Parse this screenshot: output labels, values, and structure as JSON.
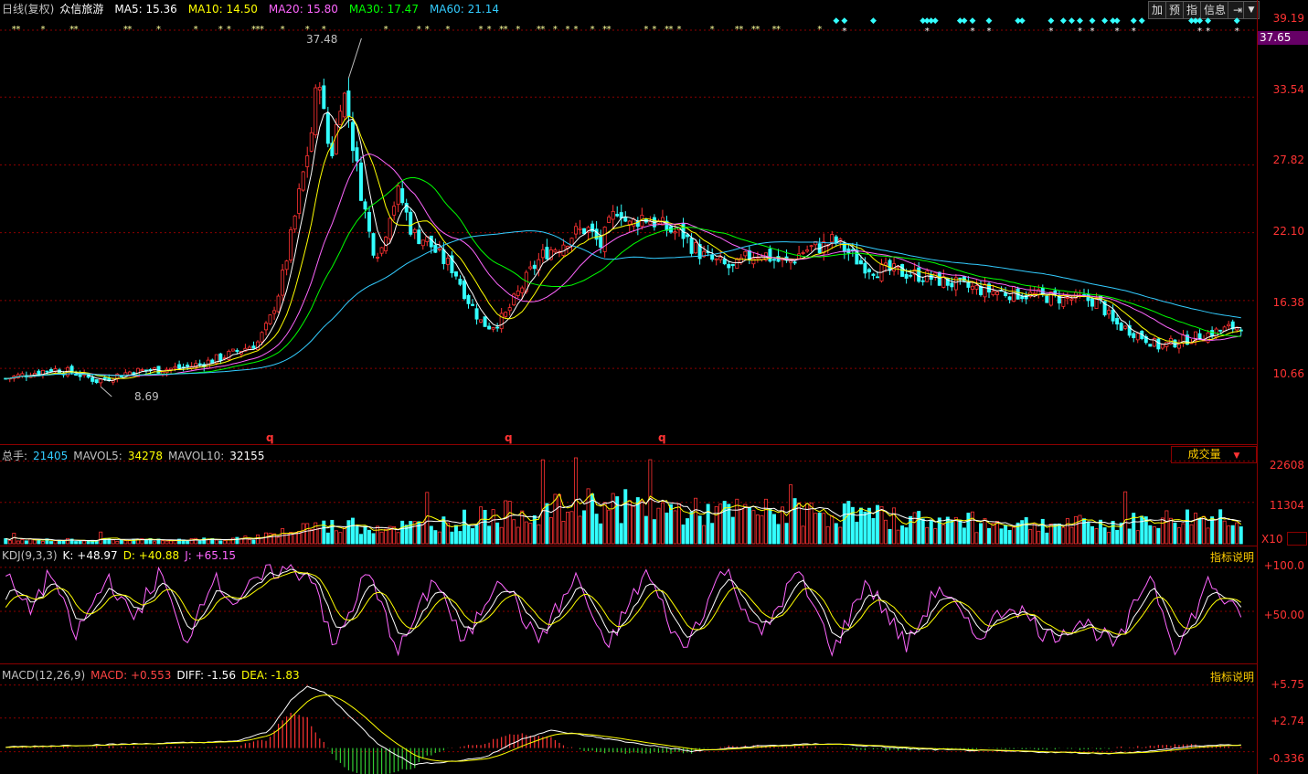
{
  "header": {
    "period": "日线(复权)",
    "stock_name": "众信旅游",
    "ma": [
      {
        "label": "MA5: 15.36",
        "color": "#ffffff"
      },
      {
        "label": "MA10: 14.50",
        "color": "#ffff00"
      },
      {
        "label": "MA20: 15.80",
        "color": "#ff66ff"
      },
      {
        "label": "MA30: 17.47",
        "color": "#00ff00"
      },
      {
        "label": "MA60: 21.14",
        "color": "#33ccff"
      }
    ],
    "buttons": [
      "加",
      "预",
      "指",
      "信息"
    ],
    "arrow_icon": "exit-arrow-icon",
    "dropdown_icon": "chevron-down-icon"
  },
  "price_axis": {
    "ticks": [
      "39.19",
      "33.54",
      "27.82",
      "22.10",
      "16.38",
      "10.66"
    ],
    "highlight": "37.65"
  },
  "annotations": {
    "high": "37.48",
    "low": "8.69",
    "markers": [
      "q",
      "q",
      "q"
    ]
  },
  "volume": {
    "header": [
      {
        "label": "总手:",
        "color": "#c0c0c0"
      },
      {
        "label": "21405",
        "color": "#33ccff"
      },
      {
        "label": "MAVOL5:",
        "color": "#c0c0c0"
      },
      {
        "label": "34278",
        "color": "#ffff00"
      },
      {
        "label": "MAVOL10:",
        "color": "#c0c0c0"
      },
      {
        "label": "32155",
        "color": "#ffffff"
      }
    ],
    "dropdown": "成交量",
    "ticks": [
      "22608",
      "11304"
    ],
    "unit": "X10"
  },
  "kdj": {
    "header": [
      {
        "label": "KDJ(9,3,3)",
        "color": "#c0c0c0"
      },
      {
        "label": "K: +48.97",
        "color": "#ffffff"
      },
      {
        "label": "D: +40.88",
        "color": "#ffff00"
      },
      {
        "label": "J: +65.15",
        "color": "#ff66ff"
      }
    ],
    "link": "指标说明",
    "ticks": [
      "+100.0",
      "+50.00"
    ]
  },
  "macd": {
    "header": [
      {
        "label": "MACD(12,26,9)",
        "color": "#c0c0c0"
      },
      {
        "label": "MACD: +0.553",
        "color": "#ff4444"
      },
      {
        "label": "DIFF: -1.56",
        "color": "#ffffff"
      },
      {
        "label": "DEA: -1.83",
        "color": "#ffff00"
      }
    ],
    "link": "指标说明",
    "ticks": [
      "+5.75",
      "+2.74",
      "-0.336"
    ]
  },
  "chart_data": {
    "type": "candlestick",
    "title": "众信旅游 日线(复权)",
    "ylim": [
      5.5,
      40.5
    ],
    "n": 300,
    "price_knots": [
      [
        0,
        9.8
      ],
      [
        20,
        10.6
      ],
      [
        30,
        10.3
      ],
      [
        40,
        9.6
      ],
      [
        55,
        10.4
      ],
      [
        70,
        10.6
      ],
      [
        80,
        10.8
      ],
      [
        90,
        11.3
      ],
      [
        100,
        12.0
      ],
      [
        110,
        12.8
      ],
      [
        115,
        14.5
      ],
      [
        120,
        17.5
      ],
      [
        125,
        22.0
      ],
      [
        130,
        27.0
      ],
      [
        134,
        31.0
      ],
      [
        137,
        36.0
      ],
      [
        140,
        30.0
      ],
      [
        143,
        29.0
      ],
      [
        147,
        34.5
      ],
      [
        150,
        32.0
      ],
      [
        153,
        28.0
      ],
      [
        156,
        25.0
      ],
      [
        160,
        21.0
      ],
      [
        164,
        20.5
      ],
      [
        168,
        24.0
      ],
      [
        172,
        25.5
      ],
      [
        178,
        22.0
      ],
      [
        184,
        21.5
      ],
      [
        190,
        20.0
      ],
      [
        196,
        19.0
      ],
      [
        202,
        16.5
      ],
      [
        208,
        14.5
      ],
      [
        212,
        14.2
      ],
      [
        218,
        15.0
      ],
      [
        224,
        17.0
      ],
      [
        230,
        19.0
      ],
      [
        236,
        20.5
      ],
      [
        242,
        21.0
      ],
      [
        248,
        22.0
      ],
      [
        254,
        22.5
      ],
      [
        260,
        21.0
      ],
      [
        264,
        22.8
      ],
      [
        268,
        24.5
      ],
      [
        272,
        22.6
      ],
      [
        278,
        23.5
      ],
      [
        284,
        23.0
      ],
      [
        290,
        22.3
      ],
      [
        296,
        22.0
      ],
      [
        300,
        21.0
      ],
      [
        306,
        20.0
      ],
      [
        312,
        19.5
      ],
      [
        318,
        19.0
      ],
      [
        324,
        20.0
      ],
      [
        330,
        20.5
      ],
      [
        336,
        19.8
      ],
      [
        342,
        19.5
      ],
      [
        348,
        20.5
      ],
      [
        352,
        20.8
      ],
      [
        358,
        21.0
      ],
      [
        362,
        21.5
      ],
      [
        368,
        20.5
      ],
      [
        374,
        19.5
      ],
      [
        380,
        19.0
      ],
      [
        390,
        18.8
      ],
      [
        400,
        18.5
      ],
      [
        410,
        18.0
      ],
      [
        420,
        17.5
      ],
      [
        430,
        17.2
      ],
      [
        440,
        17.0
      ],
      [
        450,
        16.8
      ],
      [
        460,
        16.6
      ],
      [
        470,
        16.5
      ],
      [
        478,
        16.3
      ],
      [
        484,
        14.5
      ],
      [
        492,
        13.8
      ],
      [
        500,
        13.0
      ],
      [
        504,
        12.5
      ],
      [
        510,
        12.8
      ],
      [
        518,
        13.2
      ],
      [
        526,
        13.6
      ],
      [
        534,
        14.0
      ],
      [
        540,
        14.3
      ]
    ],
    "volume_knots": [
      [
        0,
        1000
      ],
      [
        100,
        1200
      ],
      [
        125,
        3000
      ],
      [
        130,
        5000
      ],
      [
        180,
        5000
      ],
      [
        225,
        9000
      ],
      [
        265,
        11000
      ],
      [
        300,
        9000
      ],
      [
        350,
        9000
      ],
      [
        420,
        6000
      ],
      [
        480,
        5500
      ],
      [
        520,
        7500
      ],
      [
        540,
        8000
      ]
    ],
    "kdj_knots": [
      [
        0,
        90
      ],
      [
        10,
        50
      ],
      [
        20,
        95
      ],
      [
        30,
        20
      ],
      [
        45,
        90
      ],
      [
        55,
        40
      ],
      [
        68,
        95
      ],
      [
        78,
        10
      ],
      [
        90,
        90
      ],
      [
        100,
        60
      ],
      [
        115,
        95
      ],
      [
        125,
        97
      ],
      [
        135,
        90
      ],
      [
        143,
        5
      ],
      [
        158,
        95
      ],
      [
        172,
        5
      ],
      [
        188,
        90
      ],
      [
        200,
        10
      ],
      [
        216,
        95
      ],
      [
        232,
        15
      ],
      [
        250,
        90
      ],
      [
        262,
        5
      ],
      [
        280,
        95
      ],
      [
        296,
        5
      ],
      [
        314,
        100
      ],
      [
        330,
        20
      ],
      [
        346,
        95
      ],
      [
        362,
        5
      ],
      [
        376,
        85
      ],
      [
        394,
        10
      ],
      [
        408,
        80
      ],
      [
        424,
        20
      ],
      [
        440,
        60
      ],
      [
        456,
        20
      ],
      [
        470,
        40
      ],
      [
        486,
        10
      ],
      [
        500,
        95
      ],
      [
        512,
        5
      ],
      [
        526,
        85
      ],
      [
        540,
        40
      ]
    ],
    "macd_knots": [
      [
        0,
        0.1
      ],
      [
        100,
        0.6
      ],
      [
        115,
        1.5
      ],
      [
        125,
        4.5
      ],
      [
        132,
        5.6
      ],
      [
        140,
        5.0
      ],
      [
        150,
        3.0
      ],
      [
        162,
        0.5
      ],
      [
        178,
        -1.5
      ],
      [
        196,
        -1.2
      ],
      [
        210,
        -0.8
      ],
      [
        225,
        0.8
      ],
      [
        238,
        1.6
      ],
      [
        252,
        1.2
      ],
      [
        270,
        0.6
      ],
      [
        300,
        -0.3
      ],
      [
        330,
        0.2
      ],
      [
        360,
        0.4
      ],
      [
        400,
        -0.1
      ],
      [
        440,
        -0.3
      ],
      [
        480,
        -0.5
      ],
      [
        500,
        -0.3
      ],
      [
        520,
        0.2
      ],
      [
        540,
        0.3
      ]
    ]
  }
}
